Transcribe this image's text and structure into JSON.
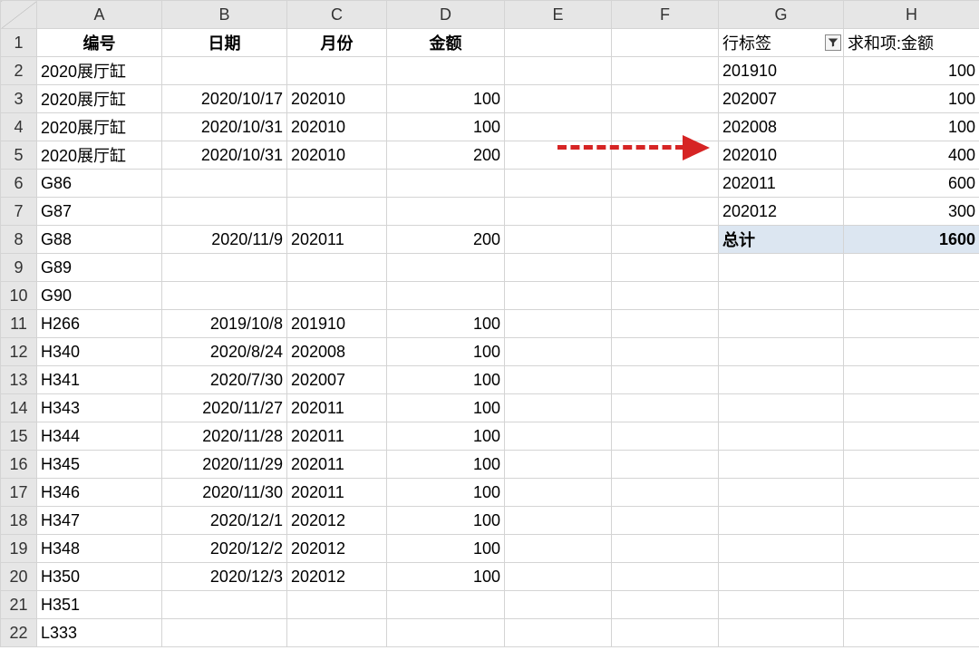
{
  "columns": [
    "A",
    "B",
    "C",
    "D",
    "E",
    "F",
    "G",
    "H"
  ],
  "row_numbers": [
    "1",
    "2",
    "3",
    "4",
    "5",
    "6",
    "7",
    "8",
    "9",
    "10",
    "11",
    "12",
    "13",
    "14",
    "15",
    "16",
    "17",
    "18",
    "19",
    "20",
    "21",
    "22"
  ],
  "header_row": {
    "A": "编号",
    "B": "日期",
    "C": "月份",
    "D": "金额",
    "G": "行标签",
    "H": "求和项:金额"
  },
  "left_rows": [
    {
      "A": "2020展厅缸",
      "B": "",
      "C": "",
      "D": ""
    },
    {
      "A": "2020展厅缸",
      "B": "2020/10/17",
      "C": "202010",
      "D": "100"
    },
    {
      "A": "2020展厅缸",
      "B": "2020/10/31",
      "C": "202010",
      "D": "100"
    },
    {
      "A": "2020展厅缸",
      "B": "2020/10/31",
      "C": "202010",
      "D": "200"
    },
    {
      "A": "G86",
      "B": "",
      "C": "",
      "D": ""
    },
    {
      "A": "G87",
      "B": "",
      "C": "",
      "D": ""
    },
    {
      "A": "G88",
      "B": "2020/11/9",
      "C": "202011",
      "D": "200"
    },
    {
      "A": "G89",
      "B": "",
      "C": "",
      "D": ""
    },
    {
      "A": "G90",
      "B": "",
      "C": "",
      "D": ""
    },
    {
      "A": "H266",
      "B": "2019/10/8",
      "C": "201910",
      "D": "100"
    },
    {
      "A": "H340",
      "B": "2020/8/24",
      "C": "202008",
      "D": "100"
    },
    {
      "A": "H341",
      "B": "2020/7/30",
      "C": "202007",
      "D": "100"
    },
    {
      "A": "H343",
      "B": "2020/11/27",
      "C": "202011",
      "D": "100"
    },
    {
      "A": "H344",
      "B": "2020/11/28",
      "C": "202011",
      "D": "100"
    },
    {
      "A": "H345",
      "B": "2020/11/29",
      "C": "202011",
      "D": "100"
    },
    {
      "A": "H346",
      "B": "2020/11/30",
      "C": "202011",
      "D": "100"
    },
    {
      "A": "H347",
      "B": "2020/12/1",
      "C": "202012",
      "D": "100"
    },
    {
      "A": "H348",
      "B": "2020/12/2",
      "C": "202012",
      "D": "100"
    },
    {
      "A": "H350",
      "B": "2020/12/3",
      "C": "202012",
      "D": "100"
    },
    {
      "A": "H351",
      "B": "",
      "C": "",
      "D": ""
    },
    {
      "A": "L333",
      "B": "",
      "C": "",
      "D": ""
    }
  ],
  "pivot_rows": [
    {
      "G": "201910",
      "H": "100"
    },
    {
      "G": "202007",
      "H": "100"
    },
    {
      "G": "202008",
      "H": "100"
    },
    {
      "G": "202010",
      "H": "400"
    },
    {
      "G": "202011",
      "H": "600"
    },
    {
      "G": "202012",
      "H": "300"
    }
  ],
  "pivot_total": {
    "G": "总计",
    "H": "1600"
  }
}
